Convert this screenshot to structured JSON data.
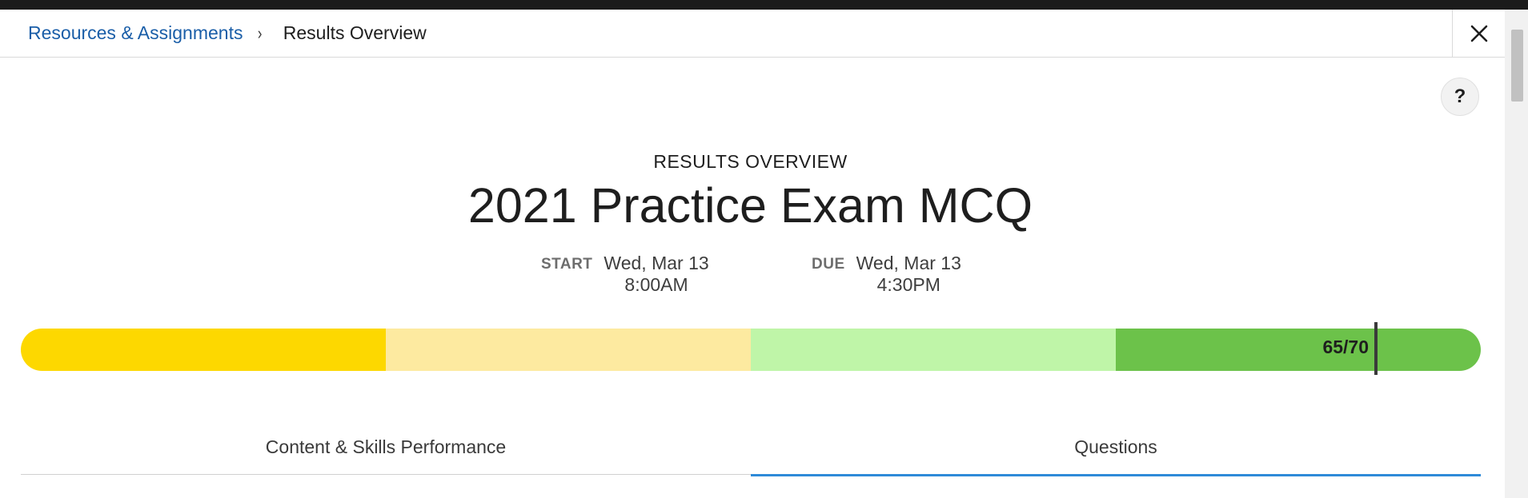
{
  "breadcrumb": {
    "parent": "Resources & Assignments",
    "separator": "›",
    "current": "Results Overview"
  },
  "help_label": "?",
  "overline": "RESULTS OVERVIEW",
  "title": "2021 Practice Exam MCQ",
  "start": {
    "label": "START",
    "date": "Wed, Mar 13",
    "time": "8:00AM"
  },
  "due": {
    "label": "DUE",
    "date": "Wed, Mar 13",
    "time": "4:30PM"
  },
  "score": {
    "label": "65/70",
    "value": 65,
    "max": 70
  },
  "score_colors": [
    "#fdd800",
    "#fdeaa0",
    "#bff5a8",
    "#6cc24a"
  ],
  "tabs": [
    {
      "label": "Content & Skills Performance",
      "active": false
    },
    {
      "label": "Questions",
      "active": true
    }
  ],
  "icons": {
    "close": "close-icon",
    "help": "help-icon",
    "chevron": "chevron-right-icon"
  }
}
